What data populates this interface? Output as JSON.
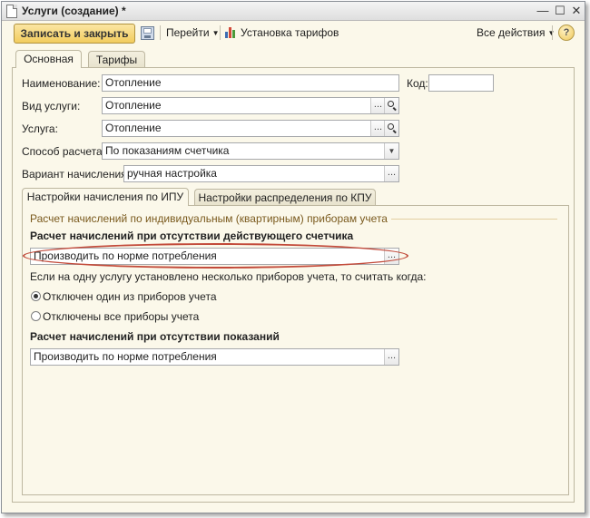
{
  "window": {
    "title": "Услуги (создание) *"
  },
  "toolbar": {
    "save_close": "Записать и закрыть",
    "goto": "Перейти",
    "tariffs_setup": "Установка тарифов",
    "all_actions": "Все действия",
    "help": "?"
  },
  "tabs": [
    {
      "label": "Основная",
      "active": true
    },
    {
      "label": "Тарифы",
      "active": false
    }
  ],
  "form": {
    "name_label": "Наименование:",
    "name_value": "Отопление",
    "code_label": "Код:",
    "code_value": "",
    "kind_label": "Вид услуги:",
    "kind_value": "Отопление",
    "service_label": "Услуга:",
    "service_value": "Отопление",
    "calc_method_label": "Способ расчета:",
    "calc_method_value": "По показаниям счетчика",
    "accrual_label": "Вариант начисления:",
    "accrual_value": "ручная настройка"
  },
  "subtabs": [
    {
      "label": "Настройки начисления по ИПУ",
      "active": true
    },
    {
      "label": "Настройки распределения по КПУ",
      "active": false
    }
  ],
  "ipu": {
    "group_title": "Расчет начислений по индивидуальным (квартирным) приборам учета",
    "no_meter_heading": "Расчет начислений при отсутствии действующего счетчика",
    "no_meter_value": "Производить по норме потребления",
    "multi_meter_question": "Если на одну услугу установлено несколько приборов учета, то считать когда:",
    "radio_one_off": "Отключен один из приборов учета",
    "radio_all_off": "Отключены все приборы учета",
    "selected_radio": "one_off",
    "no_readings_heading": "Расчет начислений при отсутствии показаний",
    "no_readings_value": "Производить по норме потребления"
  },
  "glyphs": {
    "ellipsis": "...",
    "dropdown": "▼",
    "minimize": "—",
    "maximize": "☐",
    "close": "✕"
  },
  "colors": {
    "accent_button": "#f2cc5e",
    "form_bg": "#fbf8ea",
    "group_title": "#7a5a1e",
    "highlight": "#c24a3a"
  }
}
